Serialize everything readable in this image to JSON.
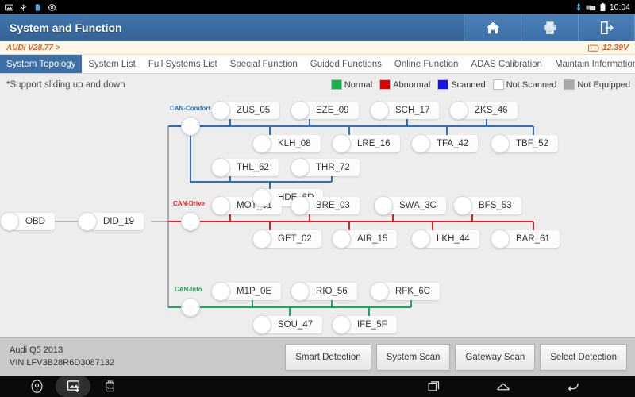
{
  "statusbar": {
    "icons": [
      "screenshot-icon",
      "usb-icon",
      "sdcard-icon",
      "settings-icon",
      "bluetooth-icon",
      "vci-link-icon",
      "battery-icon"
    ],
    "time": "10:04"
  },
  "titlebar": {
    "title": "System and Function",
    "buttons": [
      {
        "name": "home-button",
        "icon": "home-icon"
      },
      {
        "name": "print-button",
        "icon": "printer-icon"
      },
      {
        "name": "exit-button",
        "icon": "exit-icon"
      }
    ]
  },
  "version_strip": {
    "vehicle_version": "AUDI V28.77 >",
    "voltage": "12.39V",
    "voltage_color": "#e2622a"
  },
  "tabs": [
    {
      "label": "System Topology",
      "active": true
    },
    {
      "label": "System List",
      "active": false
    },
    {
      "label": "Full Systems List",
      "active": false
    },
    {
      "label": "Special Function",
      "active": false
    },
    {
      "label": "Guided Functions",
      "active": false
    },
    {
      "label": "Online Function",
      "active": false
    },
    {
      "label": "ADAS Calibration",
      "active": false
    },
    {
      "label": "Maintain Information",
      "active": false
    }
  ],
  "content": {
    "support_note": "*Support sliding up and down",
    "legend": [
      {
        "label": "Normal",
        "color": "#17b04b"
      },
      {
        "label": "Abnormal",
        "color": "#e00000"
      },
      {
        "label": "Scanned",
        "color": "#1414e6"
      },
      {
        "label": "Not Scanned",
        "color": "#ffffff"
      },
      {
        "label": "Not Equipped",
        "color": "#a8a8a8"
      }
    ]
  },
  "topology": {
    "buses": [
      {
        "name": "CAN-Comfort",
        "color": "#2d6fc4"
      },
      {
        "name": "CAN-Drive",
        "color": "#e02020"
      },
      {
        "name": "CAN-Info",
        "color": "#19a85a"
      }
    ],
    "trunk_nodes": [
      {
        "label": "OBD"
      },
      {
        "label": "DID_19"
      }
    ],
    "comfort_nodes_top": [
      "ZUS_05",
      "EZE_09",
      "SCH_17",
      "ZKS_46"
    ],
    "comfort_nodes_mid": [
      "KLH_08",
      "LRE_16",
      "TFA_42",
      "TBF_52"
    ],
    "comfort_nodes_sub": [
      "THL_62",
      "THR_72"
    ],
    "comfort_nodes_sub2": [
      "HDE_6D"
    ],
    "drive_nodes_top": [
      "MOT_01",
      "BRE_03",
      "SWA_3C",
      "BFS_53"
    ],
    "drive_nodes_bottom": [
      "GET_02",
      "AIR_15",
      "LKH_44",
      "BAR_61"
    ],
    "info_nodes_top": [
      "M1P_0E",
      "RIO_56",
      "RFK_6C"
    ],
    "info_nodes_bottom": [
      "SOU_47",
      "IFE_5F"
    ]
  },
  "bottombar": {
    "vehicle": "Audi Q5 2013",
    "vin": "VIN LFV3B28R6D3087132",
    "actions": [
      "Smart Detection",
      "System Scan",
      "Gateway Scan",
      "Select Detection"
    ]
  },
  "navbar": {
    "left_icons": [
      "compass-icon",
      "screenshot-icon",
      "vci-icon"
    ],
    "right_icons": [
      "recents-icon",
      "home-icon",
      "back-icon"
    ]
  }
}
